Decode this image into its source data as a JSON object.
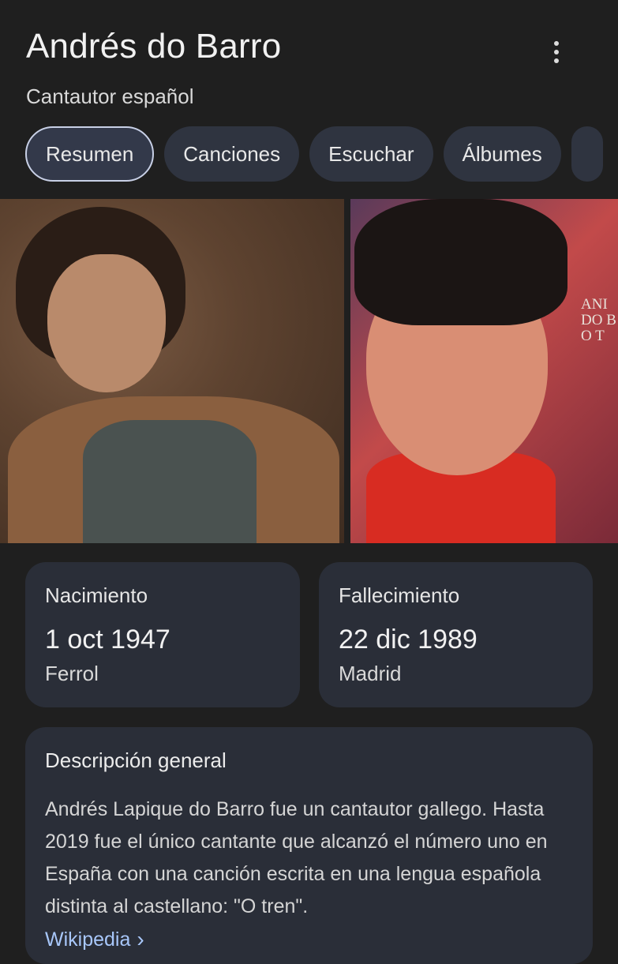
{
  "header": {
    "title": "Andrés do Barro",
    "subtitle": "Cantautor español",
    "more_icon": "more-vert-icon"
  },
  "tabs": [
    {
      "label": "Resumen",
      "active": true
    },
    {
      "label": "Canciones",
      "active": false
    },
    {
      "label": "Escuchar",
      "active": false
    },
    {
      "label": "Álbumes",
      "active": false
    }
  ],
  "images": {
    "photo2_text_lines": [
      "ANI",
      "DO B",
      "O T"
    ]
  },
  "birth": {
    "label": "Nacimiento",
    "date": "1 oct 1947",
    "place": "Ferrol"
  },
  "death": {
    "label": "Fallecimiento",
    "date": "22 dic 1989",
    "place": "Madrid"
  },
  "overview": {
    "title": "Descripción general",
    "text": "Andrés Lapique do Barro fue un cantautor gallego. Hasta 2019 fue el único cantante que alcanzó el número uno en España con una canción escrita en una lengua española distinta al castellano: \"O tren\".",
    "source_link": "Wikipedia",
    "source_icon": "chevron-right-icon"
  },
  "colors": {
    "background": "#1f1f1f",
    "card": "#2a2e38",
    "chip": "#2f3440",
    "link": "#a8c7fa"
  }
}
